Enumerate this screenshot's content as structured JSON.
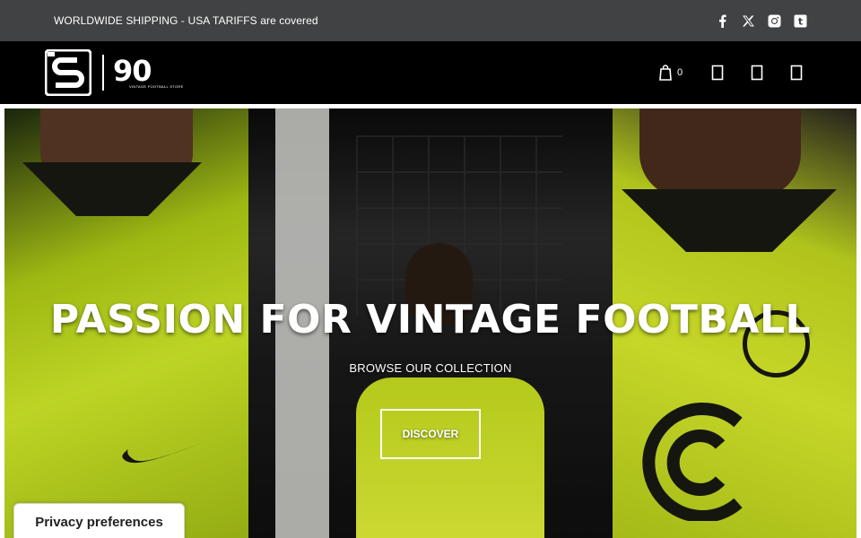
{
  "announcement": {
    "text": "WORLDWIDE SHIPPING - USA TARIFFS are covered",
    "social": [
      {
        "name": "facebook-icon"
      },
      {
        "name": "x-icon"
      },
      {
        "name": "instagram-icon"
      },
      {
        "name": "tumblr-icon"
      }
    ]
  },
  "header": {
    "logo": {
      "number": "90",
      "tagline": "VINTAGE FOOTBALL STORE"
    },
    "cart_count": "0",
    "icons": [
      "cart-icon",
      "search-icon",
      "account-icon",
      "menu-icon"
    ]
  },
  "hero": {
    "title": "PASSION FOR VINTAGE FOOTBALL",
    "subtitle": "BROWSE OUR COLLECTION",
    "button_label": "DISCOVER"
  },
  "privacy": {
    "label": "Privacy preferences"
  },
  "colors": {
    "announcement_bg": "#414243",
    "header_bg": "#000000",
    "jersey_yellow": "#d8f22a"
  }
}
